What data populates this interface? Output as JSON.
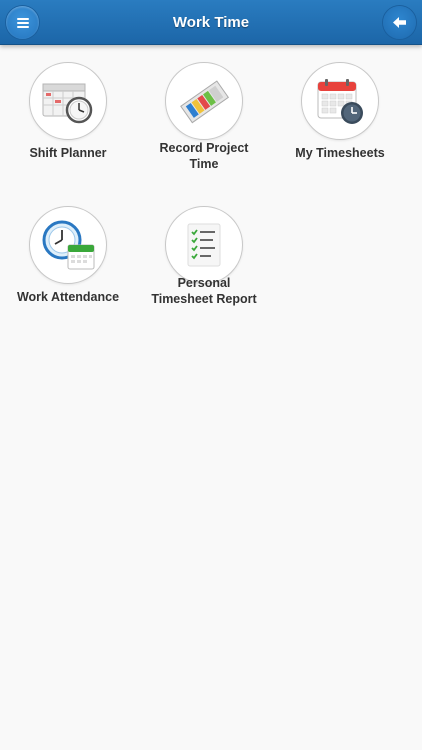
{
  "header": {
    "title": "Work Time",
    "menu_icon": "hamburger-menu-icon",
    "back_icon": "arrow-left-icon",
    "accent_color": "#1f6db2"
  },
  "tiles": [
    {
      "label": "Shift Planner",
      "icon": "shift-planner-icon"
    },
    {
      "label": "Record Project Time",
      "icon": "record-project-time-icon"
    },
    {
      "label": "My Timesheets",
      "icon": "my-timesheets-icon"
    },
    {
      "label": "Work Attendance",
      "icon": "work-attendance-icon"
    },
    {
      "label": "Personal Timesheet Report",
      "icon": "timesheet-report-icon"
    }
  ]
}
